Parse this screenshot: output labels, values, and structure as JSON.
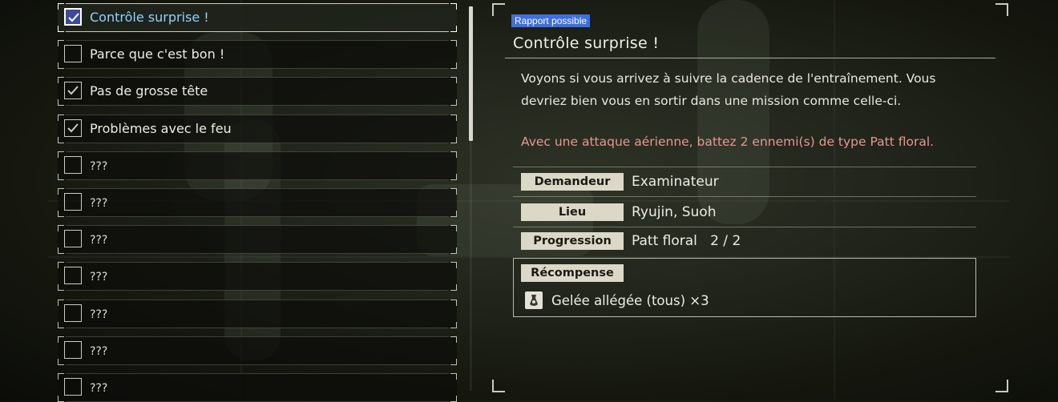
{
  "quests": [
    {
      "label": "Contrôle surprise !",
      "state": "active"
    },
    {
      "label": "Parce que c'est bon !",
      "state": "empty"
    },
    {
      "label": "Pas de grosse tête",
      "state": "done"
    },
    {
      "label": "Problèmes avec le feu",
      "state": "done"
    },
    {
      "label": "???",
      "state": "empty"
    },
    {
      "label": "???",
      "state": "empty"
    },
    {
      "label": "???",
      "state": "empty"
    },
    {
      "label": "???",
      "state": "empty"
    },
    {
      "label": "???",
      "state": "empty"
    },
    {
      "label": "???",
      "state": "empty"
    },
    {
      "label": "???",
      "state": "empty"
    }
  ],
  "detail": {
    "badge": "Rapport possible",
    "title": "Contrôle surprise !",
    "description_line1": "Voyons si vous arrivez à suivre la cadence de l'entraînement. Vous",
    "description_line2": "devriez bien vous en sortir dans une mission comme celle-ci.",
    "objective": "Avec une attaque aérienne, battez 2 ennemi(s) de type Patt floral.",
    "requester_label": "Demandeur",
    "requester_value": "Examinateur",
    "location_label": "Lieu",
    "location_value": "Ryujin, Suoh",
    "progress_label": "Progression",
    "progress_value": "Patt floral   2 / 2",
    "reward_label": "Récompense",
    "reward_item": "Gelée allégée (tous) ×3"
  },
  "colors": {
    "accent_selected": "#8fd2ff",
    "badge": "#3e6fdc",
    "objective": "#e89690",
    "label_bg": "#dcd8c8"
  }
}
